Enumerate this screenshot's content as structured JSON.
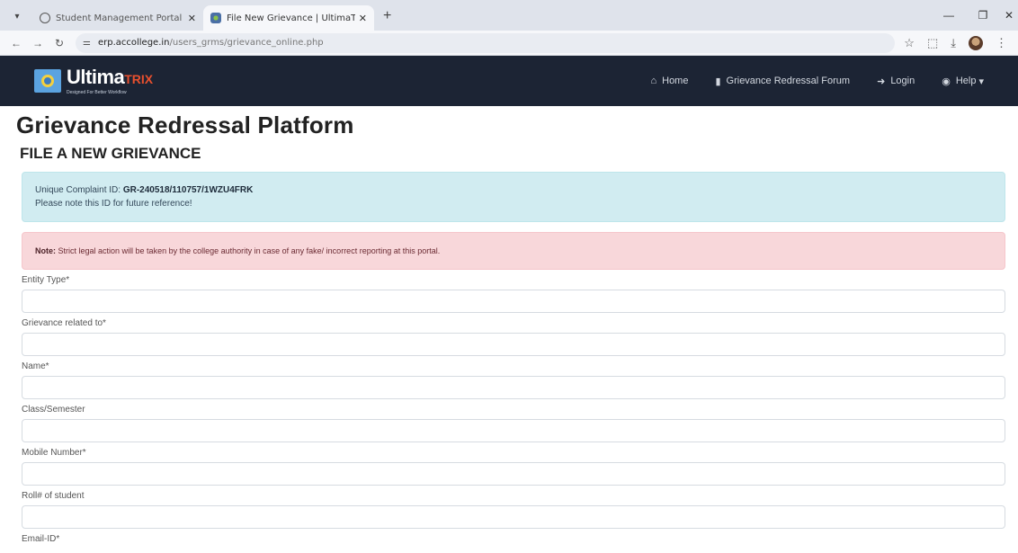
{
  "browser": {
    "tabs": [
      {
        "title": "Student Management Portal",
        "active": false
      },
      {
        "title": "File New Grievance | UltimaTRIX",
        "active": true
      }
    ],
    "url_host": "erp.accollege.in",
    "url_path": "/users_grms/grievance_online.php"
  },
  "navbar": {
    "brand_name": "Ultima",
    "brand_suffix": "TRIX",
    "brand_tagline": "Designed For Better Workflow",
    "links": [
      {
        "label": "Home",
        "icon": "home-icon"
      },
      {
        "label": "Grievance Redressal Forum",
        "icon": "document-icon"
      },
      {
        "label": "Login",
        "icon": "login-icon"
      },
      {
        "label": "Help",
        "icon": "lifebuoy-icon"
      }
    ]
  },
  "page": {
    "title": "Grievance Redressal Platform",
    "section_title": "FILE A NEW GRIEVANCE",
    "info_alert": {
      "id_label": "Unique Complaint ID:",
      "id_value": "GR-240518/110757/1WZU4FRK",
      "note": "Please note this ID for future reference!"
    },
    "warning_alert": {
      "prefix": "Note:",
      "text": "Strict legal action will be taken by the college authority in case of any fake/ incorrect reporting at this portal."
    },
    "fields": [
      {
        "label": "Entity Type*",
        "value": ""
      },
      {
        "label": "Grievance related to*",
        "value": ""
      },
      {
        "label": "Name*",
        "value": ""
      },
      {
        "label": "Class/Semester",
        "value": ""
      },
      {
        "label": "Mobile Number*",
        "value": ""
      },
      {
        "label": "Roll# of student",
        "value": ""
      },
      {
        "label": "Email-ID*",
        "value": ""
      }
    ]
  },
  "colors": {
    "navbar_bg": "#1c2434",
    "info_bg": "#d1ecf1",
    "danger_bg": "#f8d7da",
    "brand_accent": "#e8502e"
  }
}
